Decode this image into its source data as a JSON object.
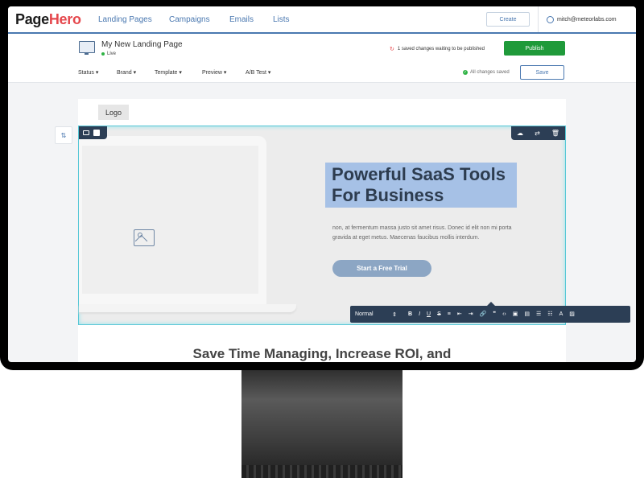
{
  "brand": {
    "name_main": "Page",
    "name_accent": "Hero"
  },
  "nav": {
    "items": [
      "Landing Pages",
      "Campaigns",
      "Emails",
      "Lists"
    ],
    "create_label": "Create",
    "account_email": "mitch@meteorlabs.com"
  },
  "page": {
    "title": "My New Landing Page",
    "status": "Live",
    "pending_text": "1 saved changes waiting to be published",
    "publish_label": "Publish"
  },
  "toolbar": {
    "menus": [
      "Status",
      "Brand",
      "Template",
      "Preview",
      "A/B Test"
    ],
    "saved_text": "All changes saved",
    "save_label": "Save"
  },
  "canvas": {
    "logo_label": "Logo",
    "headline_line1": "Powerful SaaS Tools",
    "headline_line2": "For Business",
    "body_text": "non, at fermentum massa justo sit amet risus. Donec id elit non mi porta gravida at eget metus. Maecenas faucibus mollis interdum.",
    "cta_label": "Start a Free Trial",
    "section_title": "Save Time Managing, Increase ROI, and"
  },
  "rte": {
    "style_value": "Normal"
  },
  "colors": {
    "accent": "#4a78b0",
    "publish": "#1f9a3a",
    "brand_accent": "#e5484d",
    "toolbar_dark": "#2c3e55",
    "highlight": "#a6c1e6"
  }
}
